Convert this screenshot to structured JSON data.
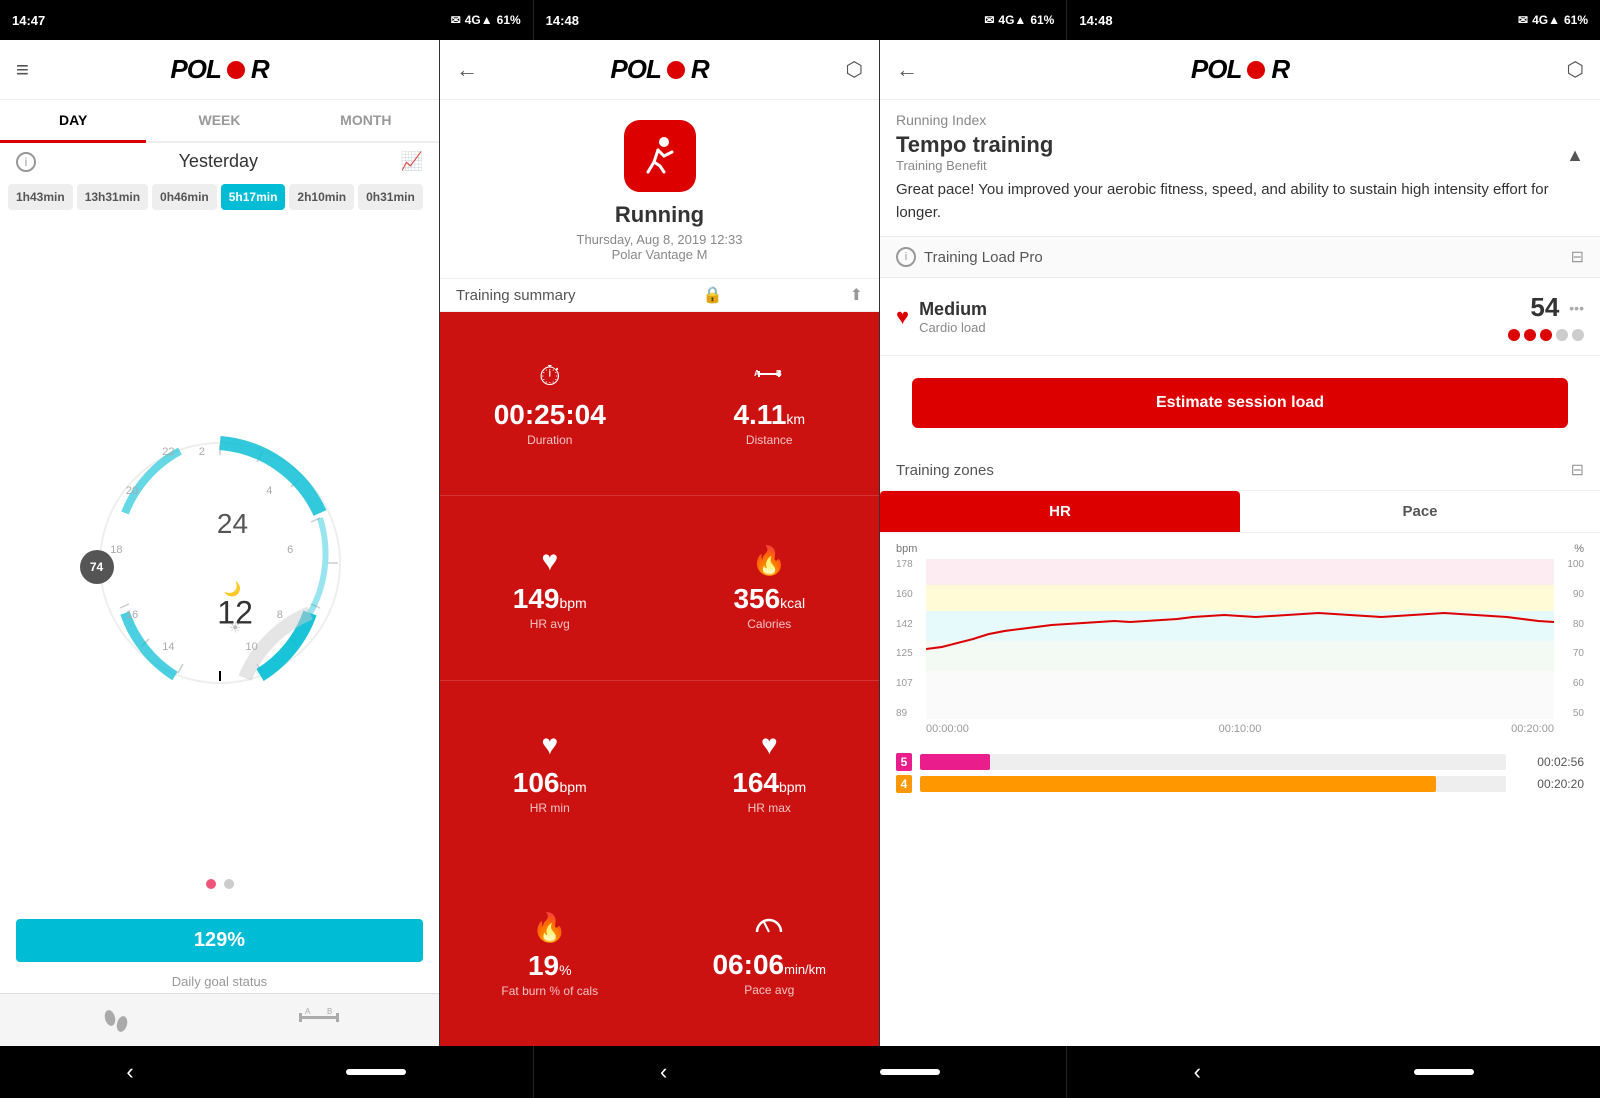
{
  "screens": [
    {
      "id": "screen1",
      "statusBar": {
        "time": "14:47",
        "network": "4G▲",
        "battery": "61%"
      },
      "header": {
        "logo": "POLAR",
        "menuIcon": "≡"
      },
      "tabs": [
        "DAY",
        "WEEK",
        "MONTH"
      ],
      "activeTab": "DAY",
      "dateLabel": "Yesterday",
      "timeBadges": [
        {
          "label": "1h43min",
          "active": false
        },
        {
          "label": "13h31min",
          "active": false
        },
        {
          "label": "0h46min",
          "active": false
        },
        {
          "label": "5h17min",
          "active": true
        },
        {
          "label": "2h10min",
          "active": false
        },
        {
          "label": "0h31min",
          "active": false
        }
      ],
      "clockNumbers": [
        "24",
        "22",
        "20",
        "18",
        "16",
        "14",
        "12",
        "10",
        "8",
        "6",
        "4",
        "2"
      ],
      "clockBadge": "74",
      "progressValue": "129%",
      "progressLabel": "Daily goal status",
      "bottomIcons": [
        "footprints",
        "distance"
      ]
    },
    {
      "id": "screen2",
      "statusBar": {
        "time": "14:48",
        "network": "4G▲",
        "battery": "61%"
      },
      "header": {
        "logo": "POLAR",
        "backIcon": "←",
        "shareIcon": "⬡"
      },
      "activityIcon": "🏃",
      "activityTitle": "Running",
      "activityDate": "Thursday, Aug 8, 2019 12:33",
      "activityDevice": "Polar Vantage M",
      "summaryLabel": "Training summary",
      "stats": [
        {
          "icon": "⏱",
          "value": "00:25:04",
          "unit": "",
          "label": "Duration"
        },
        {
          "icon": "⊢⊣",
          "value": "4.11",
          "unit": "km",
          "label": "Distance"
        },
        {
          "icon": "♥",
          "value": "149",
          "unit": "bpm",
          "label": "HR avg"
        },
        {
          "icon": "🔥",
          "value": "356",
          "unit": "kcal",
          "label": "Calories"
        },
        {
          "icon": "♥",
          "value": "106",
          "unit": "bpm",
          "label": "HR min"
        },
        {
          "icon": "♥",
          "value": "164",
          "unit": "bpm",
          "label": "HR max"
        },
        {
          "icon": "🔥",
          "value": "19",
          "unit": "%",
          "label": "Fat burn % of cals"
        },
        {
          "icon": "⊙",
          "value": "06:06",
          "unit": "min/km",
          "label": "Pace avg"
        }
      ]
    },
    {
      "id": "screen3",
      "statusBar": {
        "time": "14:48",
        "network": "4G▲",
        "battery": "61%"
      },
      "header": {
        "logo": "POLAR",
        "backIcon": "←",
        "shareIcon": "⬡"
      },
      "runningIndex": "Running Index",
      "tempoTitle": "Tempo training",
      "trainingBenefit": "Training Benefit",
      "greatText": "Great pace! You improved your aerobic fitness, speed, and ability to sustain high intensity effort for longer.",
      "tlpLabel": "Training Load Pro",
      "cardioLoad": {
        "level": "Medium",
        "label": "Cardio load",
        "value": "54",
        "dots": [
          true,
          true,
          true,
          false,
          false
        ]
      },
      "estimateBtn": "Estimate session load",
      "trainingZones": "Training zones",
      "hrTab": "HR",
      "paceTab": "Pace",
      "chartYAxis": [
        "178",
        "160",
        "142",
        "125",
        "107",
        "89"
      ],
      "chartYAxisRight": [
        "100",
        "90",
        "80",
        "70",
        "60",
        "50"
      ],
      "chartXAxis": [
        "00:00:00",
        "00:10:00",
        "00:20:00"
      ],
      "chartLabel": "bpm",
      "chartLabelRight": "%",
      "zoneBars": [
        {
          "num": "5",
          "color": "#e91e8c",
          "width": "12%",
          "time": "00:02:56"
        },
        {
          "num": "4",
          "color": "#ff9800",
          "width": "88%",
          "time": "00:20:20"
        }
      ]
    }
  ],
  "navBar": {
    "backBtn": "‹",
    "homeBtn": "",
    "backBtn2": "‹",
    "homeBtn2": "",
    "backBtn3": "‹",
    "homeBtn3": ""
  }
}
